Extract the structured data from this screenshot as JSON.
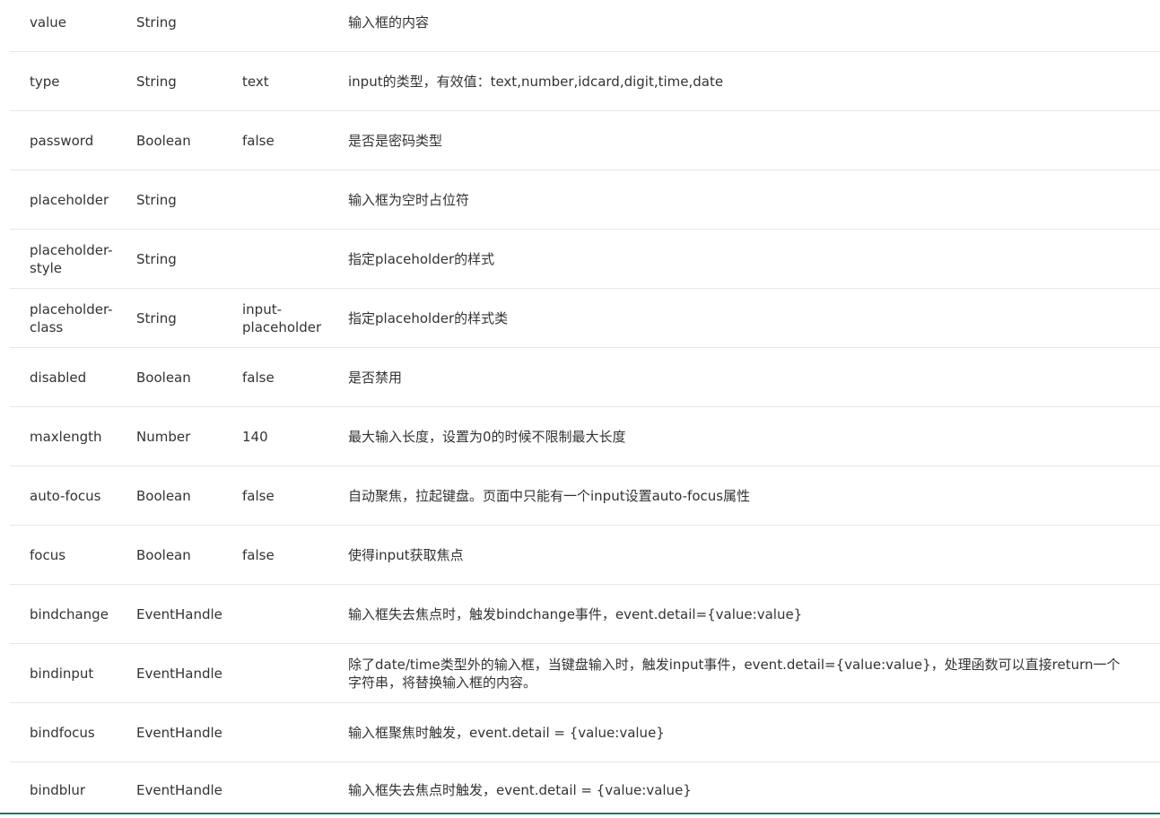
{
  "rows": [
    {
      "name": "value",
      "type": "String",
      "default": "",
      "desc": "输入框的内容"
    },
    {
      "name": "type",
      "type": "String",
      "default": "text",
      "desc": "input的类型，有效值：text,number,idcard,digit,time,date"
    },
    {
      "name": "password",
      "type": "Boolean",
      "default": "false",
      "desc": "是否是密码类型"
    },
    {
      "name": "placeholder",
      "type": "String",
      "default": "",
      "desc": "输入框为空时占位符"
    },
    {
      "name": "placeholder-style",
      "type": "String",
      "default": "",
      "desc": "指定placeholder的样式"
    },
    {
      "name": "placeholder-class",
      "type": "String",
      "default": "input-placeholder",
      "desc": "指定placeholder的样式类"
    },
    {
      "name": "disabled",
      "type": "Boolean",
      "default": "false",
      "desc": "是否禁用"
    },
    {
      "name": "maxlength",
      "type": "Number",
      "default": "140",
      "desc": "最大输入长度，设置为0的时候不限制最大长度"
    },
    {
      "name": "auto-focus",
      "type": "Boolean",
      "default": "false",
      "desc": "自动聚焦，拉起键盘。页面中只能有一个input设置auto-focus属性"
    },
    {
      "name": "focus",
      "type": "Boolean",
      "default": "false",
      "desc": "使得input获取焦点"
    },
    {
      "name": "bindchange",
      "type": "EventHandle",
      "default": "",
      "desc": "输入框失去焦点时，触发bindchange事件，event.detail={value:value}"
    },
    {
      "name": "bindinput",
      "type": "EventHandle",
      "default": "",
      "desc": "除了date/time类型外的输入框，当键盘输入时，触发input事件，event.detail={value:value}，处理函数可以直接return一个字符串，将替换输入框的内容。"
    },
    {
      "name": "bindfocus",
      "type": "EventHandle",
      "default": "",
      "desc": "输入框聚焦时触发，event.detail = {value:value}"
    },
    {
      "name": "bindblur",
      "type": "EventHandle",
      "default": "",
      "desc": "输入框失去焦点时触发，event.detail = {value:value}"
    }
  ]
}
